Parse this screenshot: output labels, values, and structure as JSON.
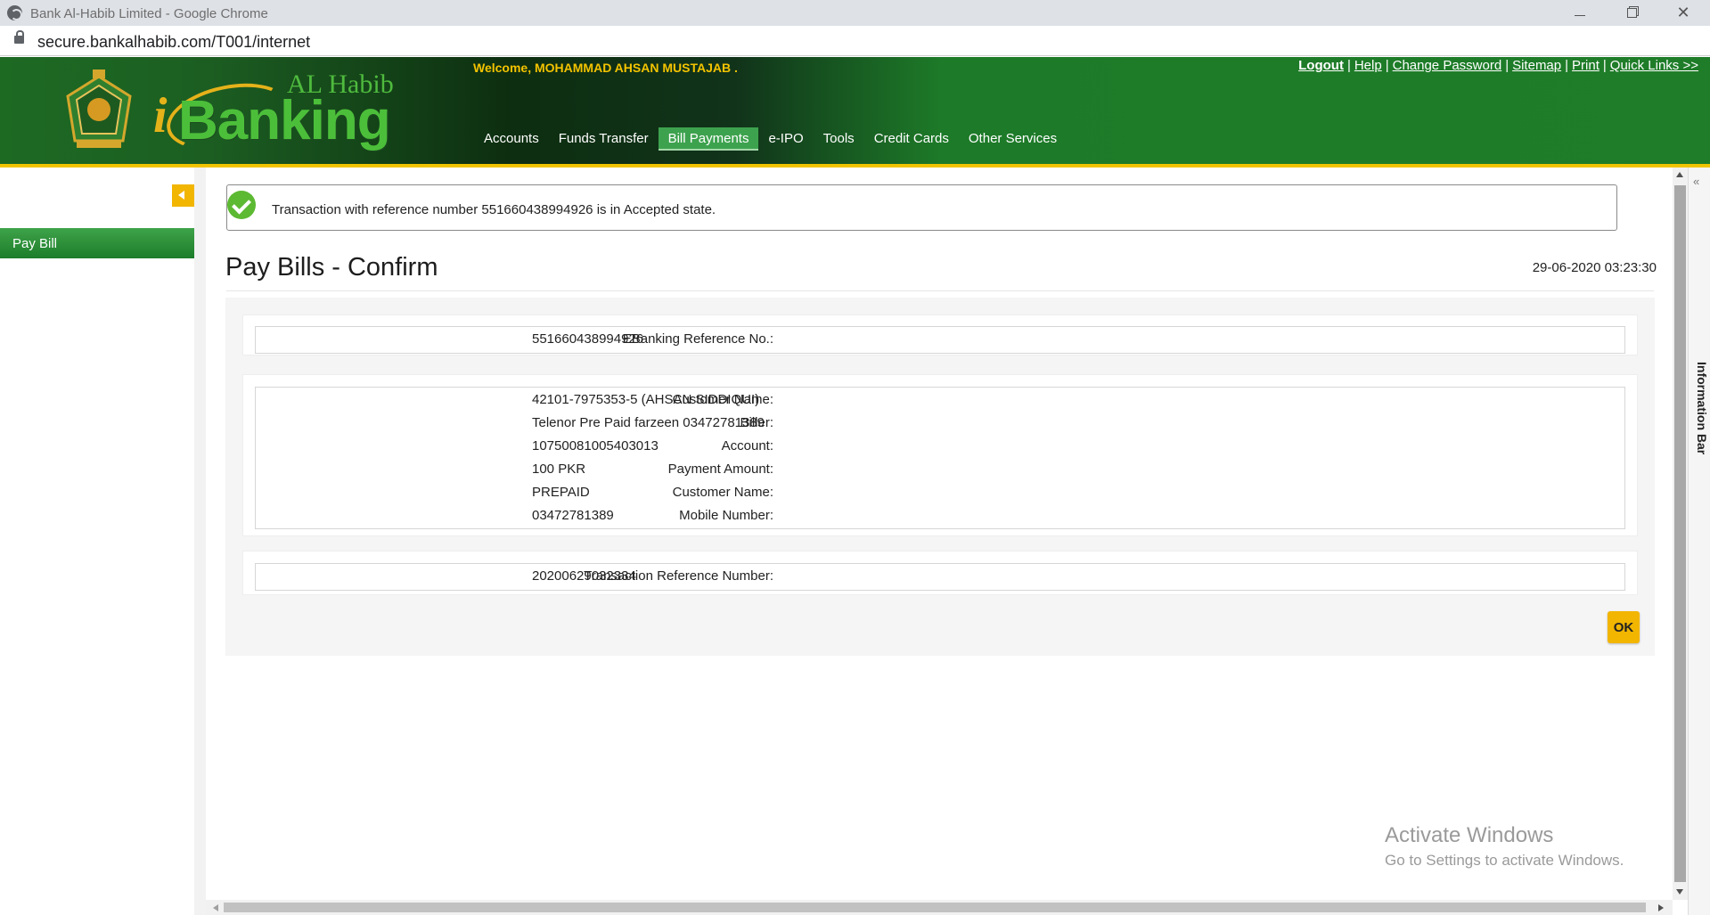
{
  "window": {
    "title": "Bank Al-Habib Limited - Google Chrome",
    "url": "secure.bankalhabib.com/T001/internet"
  },
  "header": {
    "logo_top": "AL Habib",
    "logo_i": "i",
    "logo_main": "Banking",
    "welcome": "Welcome, MOHAMMAD AHSAN MUSTAJAB .",
    "links": {
      "logout": "Logout",
      "help": "Help",
      "change_password": "Change Password",
      "sitemap": "Sitemap",
      "print": "Print",
      "quick_links": "Quick Links >>"
    },
    "nav": [
      "Accounts",
      "Funds Transfer",
      "Bill Payments",
      "e-IPO",
      "Tools",
      "Credit Cards",
      "Other Services"
    ],
    "active_nav": "Bill Payments"
  },
  "sidebar": {
    "items": [
      {
        "label": "Pay Bill"
      }
    ]
  },
  "main": {
    "message": "Transaction with reference number 551660438994926 is in Accepted state.",
    "title": "Pay Bills - Confirm",
    "datetime": "29-06-2020 03:23:30",
    "section1": {
      "label": "EBanking Reference No.:",
      "value": "551660438994926"
    },
    "details": [
      {
        "label": "Customer Name:",
        "value": "42101-7975353-5 (AHSAN SIDDIQUI)"
      },
      {
        "label": "Biller:",
        "value": "Telenor Pre Paid farzeen 03472781389"
      },
      {
        "label": "Account:",
        "value": "10750081005403013"
      },
      {
        "label": "Payment Amount:",
        "value": "100 PKR"
      },
      {
        "label": "Customer Name:",
        "value": "PREPAID"
      },
      {
        "label": "Mobile Number:",
        "value": "03472781389"
      }
    ],
    "section3": {
      "label": "Transaction Reference Number:",
      "value": "20200629032334"
    },
    "ok_label": "OK"
  },
  "infobar": {
    "label": "Information Bar",
    "toggle": "«"
  },
  "watermark": {
    "line1": "Activate Windows",
    "line2": "Go to Settings to activate Windows."
  },
  "colors": {
    "brand_green": "#1f7d29",
    "accent_yellow": "#f2b500",
    "success_green": "#5cb932"
  }
}
